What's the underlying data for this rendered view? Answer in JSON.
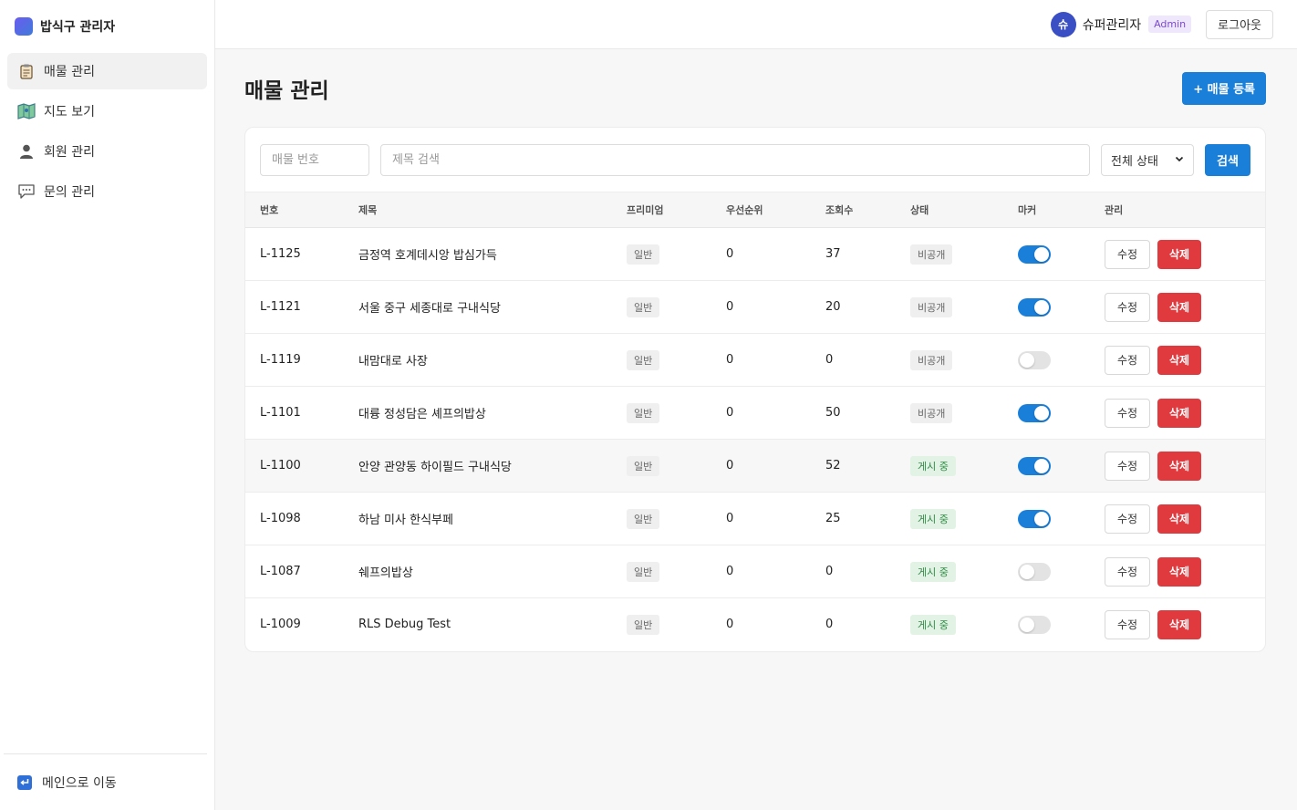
{
  "sidebar": {
    "brand": "밥식구 관리자",
    "items": [
      {
        "label": "매물 관리",
        "icon": "clipboard-icon",
        "active": true
      },
      {
        "label": "지도 보기",
        "icon": "map-icon",
        "active": false
      },
      {
        "label": "회원 관리",
        "icon": "user-icon",
        "active": false
      },
      {
        "label": "문의 관리",
        "icon": "chat-icon",
        "active": false
      }
    ],
    "footer_label": "메인으로 이동"
  },
  "topbar": {
    "avatar_initial": "슈",
    "user_name": "슈퍼관리자",
    "role": "Admin",
    "logout_label": "로그아웃"
  },
  "main": {
    "title": "매물 관리",
    "add_button": "+ 매물 등록"
  },
  "filters": {
    "id_placeholder": "매물 번호",
    "title_placeholder": "제목 검색",
    "status_value": "전체 상태",
    "search_button": "검색"
  },
  "table": {
    "headers": [
      "번호",
      "제목",
      "프리미엄",
      "우선순위",
      "조회수",
      "상태",
      "마커",
      "관리"
    ],
    "edit_label": "수정",
    "delete_label": "삭제",
    "rows": [
      {
        "id": "L-1125",
        "title": "금정역 호계데시앙 밥심가득",
        "premium": "일반",
        "priority": "0",
        "views": "37",
        "status": "비공개",
        "live": false,
        "marker": true
      },
      {
        "id": "L-1121",
        "title": "서울 중구 세종대로 구내식당",
        "premium": "일반",
        "priority": "0",
        "views": "20",
        "status": "비공개",
        "live": false,
        "marker": true
      },
      {
        "id": "L-1119",
        "title": "내맘대로 사장",
        "premium": "일반",
        "priority": "0",
        "views": "0",
        "status": "비공개",
        "live": false,
        "marker": false
      },
      {
        "id": "L-1101",
        "title": "대륭 정성담은 셰프의밥상",
        "premium": "일반",
        "priority": "0",
        "views": "50",
        "status": "비공개",
        "live": false,
        "marker": true
      },
      {
        "id": "L-1100",
        "title": "안양 관양동 하이필드 구내식당",
        "premium": "일반",
        "priority": "0",
        "views": "52",
        "status": "게시 중",
        "live": true,
        "marker": true
      },
      {
        "id": "L-1098",
        "title": "하남 미사 한식부페",
        "premium": "일반",
        "priority": "0",
        "views": "25",
        "status": "게시 중",
        "live": true,
        "marker": true
      },
      {
        "id": "L-1087",
        "title": "쉐프의밥상",
        "premium": "일반",
        "priority": "0",
        "views": "0",
        "status": "게시 중",
        "live": true,
        "marker": false
      },
      {
        "id": "L-1009",
        "title": "RLS Debug Test",
        "premium": "일반",
        "priority": "0",
        "views": "0",
        "status": "게시 중",
        "live": true,
        "marker": false
      }
    ]
  },
  "colors": {
    "primary": "#1a7fd9",
    "danger": "#e0393e",
    "live_tag": "#2f8a44",
    "admin_badge": "#7b4bd1"
  }
}
